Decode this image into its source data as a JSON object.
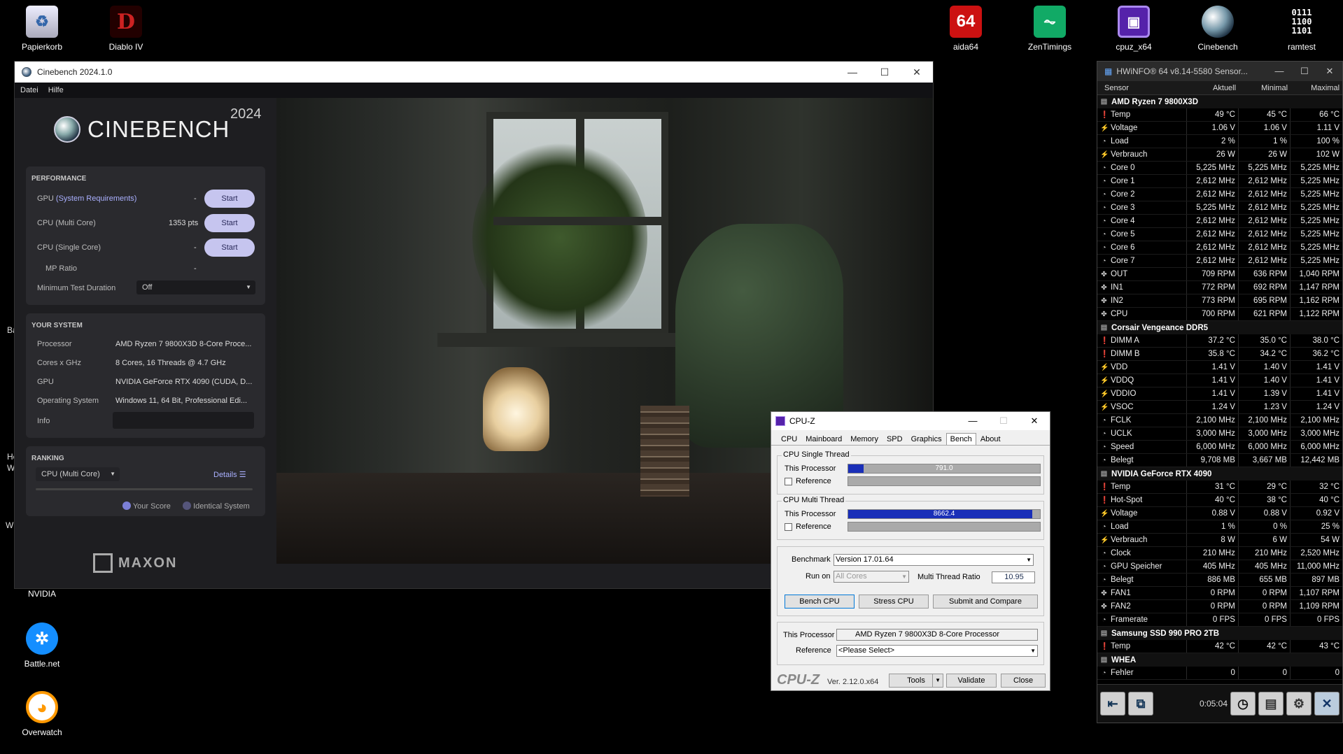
{
  "desktop": {
    "icons": [
      {
        "label": "Papierkorb",
        "icon": "recycle-bin-icon"
      },
      {
        "label": "Diablo IV",
        "icon": "diablo-icon"
      },
      {
        "label": "aida64",
        "icon": "aida64-icon",
        "glyph": "64"
      },
      {
        "label": "ZenTimings",
        "icon": "zentimings-icon"
      },
      {
        "label": "cpuz_x64",
        "icon": "cpuz-icon"
      },
      {
        "label": "Cinebench",
        "icon": "cinebench-icon"
      },
      {
        "label": "ramtest",
        "icon": "ramtest-icon",
        "glyph": "0111\n1100\n1101"
      },
      {
        "label": "NVIDIA",
        "icon": "nvidia-icon"
      },
      {
        "label": "Battle.net",
        "icon": "battlenet-icon"
      },
      {
        "label": "Overwatch",
        "icon": "overwatch-icon"
      }
    ],
    "edge_text": [
      "Ba",
      "He",
      "W",
      "W"
    ]
  },
  "cinebench": {
    "title": "Cinebench 2024.1.0",
    "menu": [
      "Datei",
      "Hilfe"
    ],
    "logo": "CINEBENCH",
    "year": "2024",
    "performance": {
      "header": "PERFORMANCE",
      "gpu_label": "GPU",
      "gpu_link": "(System Requirements)",
      "gpu_value": "-",
      "multi_label": "CPU (Multi Core)",
      "multi_value": "1353 pts",
      "single_label": "CPU (Single Core)",
      "single_value": "-",
      "mp_label": "MP Ratio",
      "mp_value": "-",
      "start_label": "Start",
      "duration_label": "Minimum Test Duration",
      "duration_value": "Off"
    },
    "system": {
      "header": "YOUR SYSTEM",
      "rows": [
        {
          "label": "Processor",
          "value": "AMD Ryzen 7 9800X3D 8-Core Proce..."
        },
        {
          "label": "Cores x GHz",
          "value": "8 Cores, 16 Threads @ 4.7 GHz"
        },
        {
          "label": "GPU",
          "value": "NVIDIA GeForce RTX 4090 (CUDA, D..."
        },
        {
          "label": "Operating System",
          "value": "Windows 11, 64 Bit, Professional Edi..."
        },
        {
          "label": "Info",
          "value": ""
        }
      ]
    },
    "ranking": {
      "header": "RANKING",
      "select": "CPU (Multi Core)",
      "details": "Details",
      "legend_yours": "Your Score",
      "legend_identical": "Identical System"
    },
    "maxon": "MAXON"
  },
  "hwinfo": {
    "title": "HWiNFO® 64 v8.14-5580 Sensor...",
    "columns": [
      "Sensor",
      "Aktuell",
      "Minimal",
      "Maximal"
    ],
    "groups": [
      {
        "name": "AMD Ryzen 7 9800X3D",
        "rows": [
          {
            "t": "temp",
            "n": "Temp",
            "a": "49 °C",
            "mi": "45 °C",
            "ma": "66 °C"
          },
          {
            "t": "volt",
            "n": "Voltage",
            "a": "1.06 V",
            "mi": "1.06 V",
            "ma": "1.11 V"
          },
          {
            "t": "clk",
            "n": "Load",
            "a": "2 %",
            "mi": "1 %",
            "ma": "100 %"
          },
          {
            "t": "volt",
            "n": "Verbrauch",
            "a": "26 W",
            "mi": "26 W",
            "ma": "102 W"
          },
          {
            "t": "clk",
            "n": "Core 0",
            "a": "5,225 MHz",
            "mi": "5,225 MHz",
            "ma": "5,225 MHz"
          },
          {
            "t": "clk",
            "n": "Core 1",
            "a": "2,612 MHz",
            "mi": "2,612 MHz",
            "ma": "5,225 MHz"
          },
          {
            "t": "clk",
            "n": "Core 2",
            "a": "2,612 MHz",
            "mi": "2,612 MHz",
            "ma": "5,225 MHz"
          },
          {
            "t": "clk",
            "n": "Core 3",
            "a": "5,225 MHz",
            "mi": "2,612 MHz",
            "ma": "5,225 MHz"
          },
          {
            "t": "clk",
            "n": "Core 4",
            "a": "2,612 MHz",
            "mi": "2,612 MHz",
            "ma": "5,225 MHz"
          },
          {
            "t": "clk",
            "n": "Core 5",
            "a": "2,612 MHz",
            "mi": "2,612 MHz",
            "ma": "5,225 MHz"
          },
          {
            "t": "clk",
            "n": "Core 6",
            "a": "2,612 MHz",
            "mi": "2,612 MHz",
            "ma": "5,225 MHz"
          },
          {
            "t": "clk",
            "n": "Core 7",
            "a": "2,612 MHz",
            "mi": "2,612 MHz",
            "ma": "5,225 MHz"
          },
          {
            "t": "fan",
            "n": "OUT",
            "a": "709 RPM",
            "mi": "636 RPM",
            "ma": "1,040 RPM"
          },
          {
            "t": "fan",
            "n": "IN1",
            "a": "772 RPM",
            "mi": "692 RPM",
            "ma": "1,147 RPM"
          },
          {
            "t": "fan",
            "n": "IN2",
            "a": "773 RPM",
            "mi": "695 RPM",
            "ma": "1,162 RPM"
          },
          {
            "t": "fan",
            "n": "CPU",
            "a": "700 RPM",
            "mi": "621 RPM",
            "ma": "1,122 RPM"
          }
        ]
      },
      {
        "name": "Corsair Vengeance DDR5",
        "rows": [
          {
            "t": "temp",
            "n": "DIMM A",
            "a": "37.2 °C",
            "mi": "35.0 °C",
            "ma": "38.0 °C"
          },
          {
            "t": "temp",
            "n": "DIMM B",
            "a": "35.8 °C",
            "mi": "34.2 °C",
            "ma": "36.2 °C"
          },
          {
            "t": "volt",
            "n": "VDD",
            "a": "1.41 V",
            "mi": "1.40 V",
            "ma": "1.41 V"
          },
          {
            "t": "volt",
            "n": "VDDQ",
            "a": "1.41 V",
            "mi": "1.40 V",
            "ma": "1.41 V"
          },
          {
            "t": "volt",
            "n": "VDDIO",
            "a": "1.41 V",
            "mi": "1.39 V",
            "ma": "1.41 V"
          },
          {
            "t": "volt",
            "n": "VSOC",
            "a": "1.24 V",
            "mi": "1.23 V",
            "ma": "1.24 V"
          },
          {
            "t": "clk",
            "n": "FCLK",
            "a": "2,100 MHz",
            "mi": "2,100 MHz",
            "ma": "2,100 MHz"
          },
          {
            "t": "clk",
            "n": "UCLK",
            "a": "3,000 MHz",
            "mi": "3,000 MHz",
            "ma": "3,000 MHz"
          },
          {
            "t": "clk",
            "n": "Speed",
            "a": "6,000 MHz",
            "mi": "6,000 MHz",
            "ma": "6,000 MHz"
          },
          {
            "t": "clk",
            "n": "Belegt",
            "a": "9,708 MB",
            "mi": "3,667 MB",
            "ma": "12,442 MB"
          }
        ]
      },
      {
        "name": "NVIDIA GeForce RTX 4090",
        "rows": [
          {
            "t": "temp",
            "n": "Temp",
            "a": "31 °C",
            "mi": "29 °C",
            "ma": "32 °C"
          },
          {
            "t": "temp",
            "n": "Hot-Spot",
            "a": "40 °C",
            "mi": "38 °C",
            "ma": "40 °C"
          },
          {
            "t": "volt",
            "n": "Voltage",
            "a": "0.88 V",
            "mi": "0.88 V",
            "ma": "0.92 V"
          },
          {
            "t": "clk",
            "n": "Load",
            "a": "1 %",
            "mi": "0 %",
            "ma": "25 %"
          },
          {
            "t": "volt",
            "n": "Verbrauch",
            "a": "8 W",
            "mi": "6 W",
            "ma": "54 W"
          },
          {
            "t": "clk",
            "n": "Clock",
            "a": "210 MHz",
            "mi": "210 MHz",
            "ma": "2,520 MHz"
          },
          {
            "t": "clk",
            "n": "GPU Speicher",
            "a": "405 MHz",
            "mi": "405 MHz",
            "ma": "11,000 MHz"
          },
          {
            "t": "clk",
            "n": "Belegt",
            "a": "886 MB",
            "mi": "655 MB",
            "ma": "897 MB"
          },
          {
            "t": "fan",
            "n": "FAN1",
            "a": "0 RPM",
            "mi": "0 RPM",
            "ma": "1,107 RPM"
          },
          {
            "t": "fan",
            "n": "FAN2",
            "a": "0 RPM",
            "mi": "0 RPM",
            "ma": "1,109 RPM"
          },
          {
            "t": "clk",
            "n": "Framerate",
            "a": "0 FPS",
            "mi": "0 FPS",
            "ma": "0 FPS"
          }
        ]
      },
      {
        "name": "Samsung SSD 990 PRO 2TB",
        "rows": [
          {
            "t": "temp",
            "n": "Temp",
            "a": "42 °C",
            "mi": "42 °C",
            "ma": "43 °C"
          }
        ]
      },
      {
        "name": "WHEA",
        "rows": [
          {
            "t": "clk",
            "n": "Fehler",
            "a": "0",
            "mi": "0",
            "ma": "0"
          }
        ]
      }
    ],
    "timer": "0:05:04"
  },
  "cpuz": {
    "title": "CPU-Z",
    "tabs": [
      "CPU",
      "Mainboard",
      "Memory",
      "SPD",
      "Graphics",
      "Bench",
      "About"
    ],
    "active_tab": "Bench",
    "single": {
      "legend": "CPU Single Thread",
      "this_label": "This Processor",
      "ref_label": "Reference",
      "score": "791.0",
      "fraction": 0.08
    },
    "multi": {
      "legend": "CPU Multi Thread",
      "this_label": "This Processor",
      "ref_label": "Reference",
      "score": "8662.4",
      "fraction": 0.96
    },
    "benchmark_label": "Benchmark",
    "benchmark_value": "Version 17.01.64",
    "runon_label": "Run on",
    "runon_value": "All Cores",
    "mtr_label": "Multi Thread Ratio",
    "mtr_value": "10.95",
    "bench_btn": "Bench CPU",
    "stress_btn": "Stress CPU",
    "submit_btn": "Submit and Compare",
    "this_proc_label": "This Processor",
    "this_proc_value": "AMD Ryzen 7 9800X3D 8-Core Processor",
    "reference_label": "Reference",
    "reference_value": "<Please Select>",
    "brand": "CPU-Z",
    "version": "Ver. 2.12.0.x64",
    "tools_btn": "Tools",
    "validate_btn": "Validate",
    "close_btn": "Close"
  }
}
